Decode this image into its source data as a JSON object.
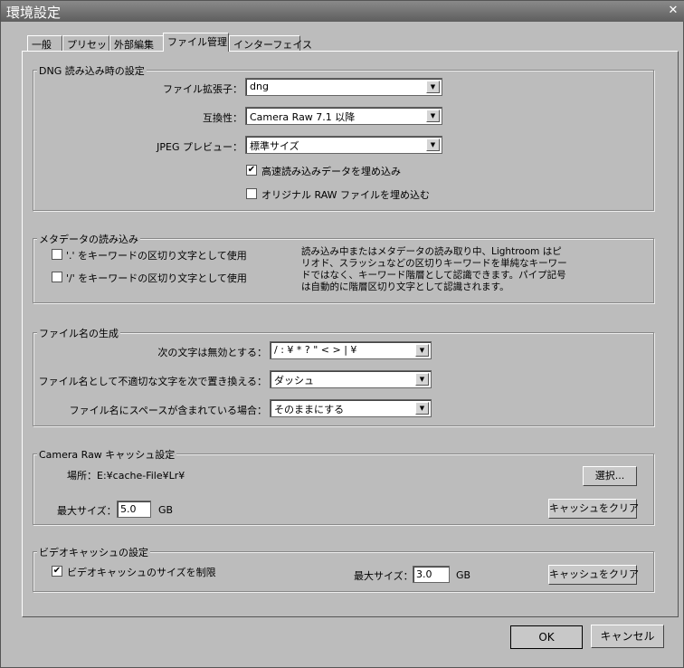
{
  "window": {
    "title": "環境設定",
    "close": "✕"
  },
  "tabs": [
    {
      "label": "一般"
    },
    {
      "label": "プリセット"
    },
    {
      "label": "外部編集"
    },
    {
      "label": "ファイル管理"
    },
    {
      "label": "インターフェイス"
    }
  ],
  "dng": {
    "title": "DNG 読み込み時の設定",
    "ext_label": "ファイル拡張子：",
    "ext_value": "dng",
    "compat_label": "互換性：",
    "compat_value": "Camera Raw 7.1 以降",
    "jpeg_label": "JPEG プレビュー：",
    "jpeg_value": "標準サイズ",
    "fast_label": "高速読み込みデータを埋め込み",
    "fast_checked": true,
    "raw_label": "オリジナル RAW ファイルを埋め込む",
    "raw_checked": false
  },
  "metadata": {
    "title": "メタデータの読み込み",
    "dot_label": "'.' をキーワードの区切り文字として使用",
    "dot_checked": false,
    "slash_label": "'/' をキーワードの区切り文字として使用",
    "slash_checked": false,
    "description": "読み込み中またはメタデータの読み取り中、Lightroom はピリオド、スラッシュなどの区切りキーワードを単純なキーワードではなく、キーワード階層として認識できます。パイプ記号は自動的に階層区切り文字として認識されます。"
  },
  "filename": {
    "title": "ファイル名の生成",
    "illegal_label": "次の文字は無効とする：",
    "illegal_value": "/ : ¥ * ? \" < > | ¥",
    "replace_label": "ファイル名として不適切な文字を次で置き換える：",
    "replace_value": "ダッシュ",
    "space_label": "ファイル名にスペースが含まれている場合：",
    "space_value": "そのままにする"
  },
  "cameraraw": {
    "title": "Camera Raw キャッシュ設定",
    "location": "場所：E:¥cache-File¥Lr¥",
    "choose": "選択...",
    "max_label": "最大サイズ：",
    "max_value": "5.0",
    "unit": "GB",
    "clear": "キャッシュをクリア"
  },
  "video": {
    "title": "ビデオキャッシュの設定",
    "limit_label": "ビデオキャッシュのサイズを制限",
    "limit_checked": true,
    "max_label": "最大サイズ：",
    "max_value": "3.0",
    "unit": "GB",
    "clear": "キャッシュをクリア"
  },
  "footer": {
    "ok": "OK",
    "cancel": "キャンセル"
  },
  "icons": {
    "check": "✔",
    "arrow": "▼"
  }
}
